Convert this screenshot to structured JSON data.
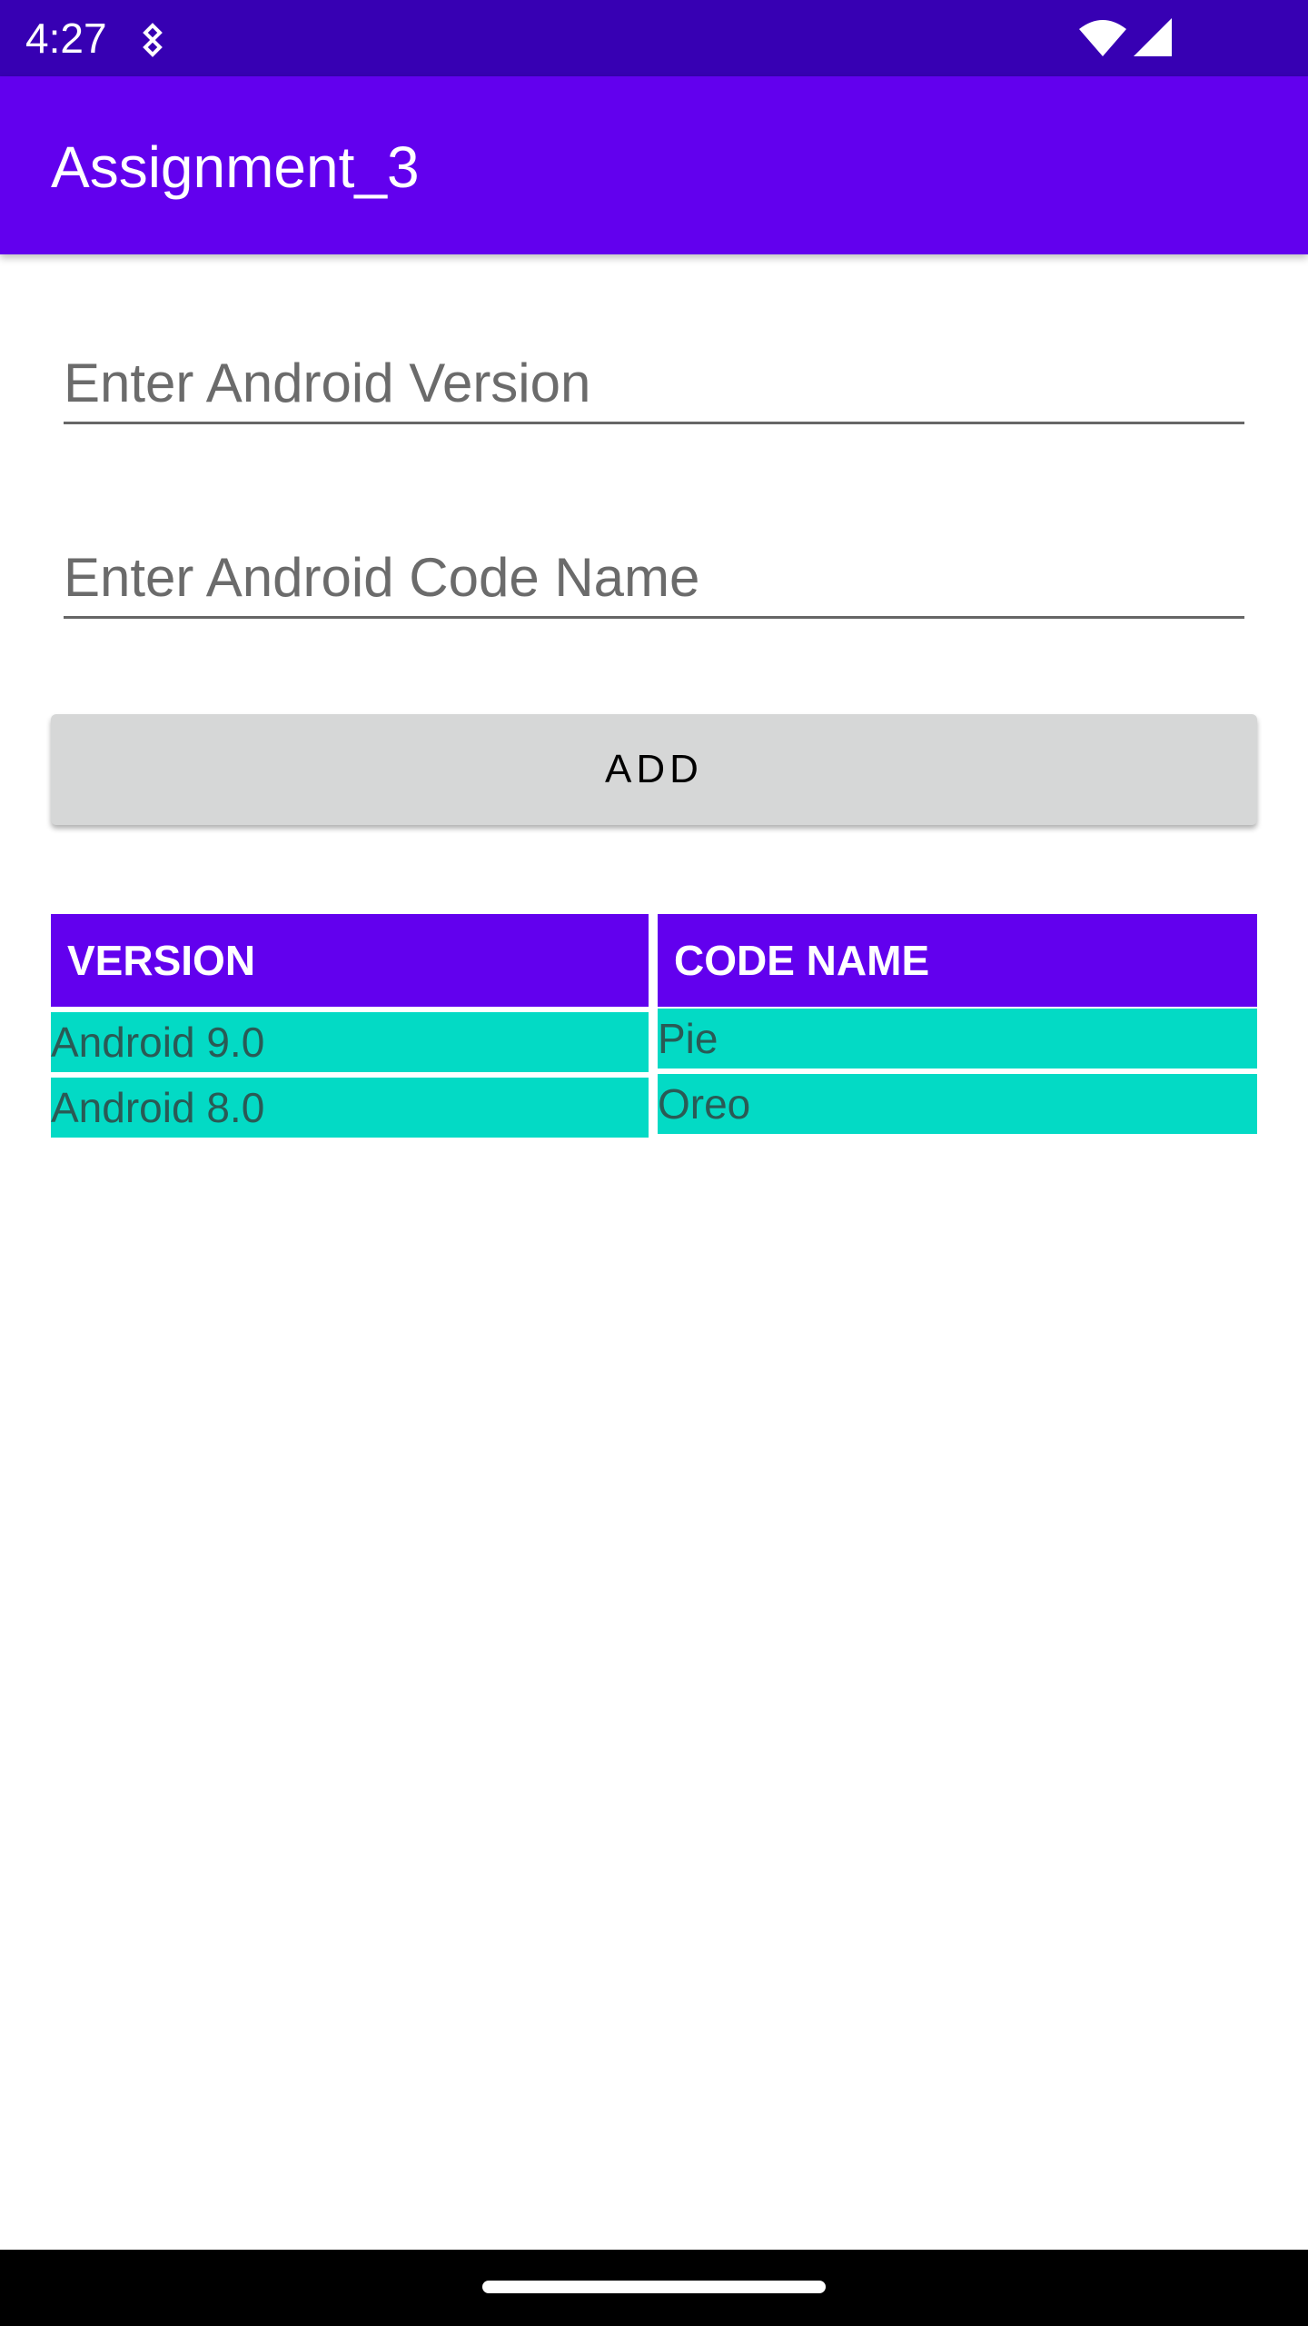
{
  "status_bar": {
    "time": "4:27",
    "icons": [
      "notification-icon",
      "wifi-icon",
      "signal-icon"
    ]
  },
  "app_bar": {
    "title": "Assignment_3"
  },
  "form": {
    "version_placeholder": "Enter Android Version",
    "version_value": "",
    "codename_placeholder": "Enter Android Code Name",
    "codename_value": "",
    "add_label": "ADD"
  },
  "table": {
    "headers": [
      "VERSION",
      "CODE NAME"
    ],
    "rows": [
      [
        "Android 9.0",
        "Pie"
      ],
      [
        "Android 8.0",
        "Oreo"
      ]
    ]
  },
  "colors": {
    "status_bar": "#3700B3",
    "primary": "#6200EE",
    "accent": "#03DAC5",
    "button": "#D6D7D7"
  }
}
